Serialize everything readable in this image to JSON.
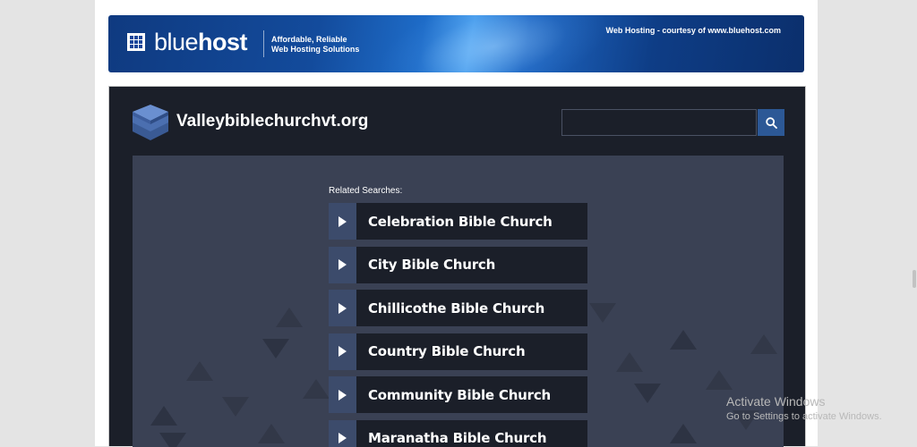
{
  "banner": {
    "brand_light": "blue",
    "brand_bold": "host",
    "tagline_line1": "Affordable, Reliable",
    "tagline_line2": "Web Hosting Solutions",
    "courtesy": "Web Hosting - courtesy of www.bluehost.com"
  },
  "site": {
    "title": "Valleybiblechurchvt.org",
    "search": {
      "value": "",
      "placeholder": ""
    },
    "related_label": "Related Searches:",
    "links": [
      {
        "label": "Celebration Bible Church"
      },
      {
        "label": "City Bible Church"
      },
      {
        "label": "Chillicothe Bible Church"
      },
      {
        "label": "Country Bible Church"
      },
      {
        "label": "Community Bible Church"
      },
      {
        "label": "Maranatha Bible Church"
      }
    ]
  },
  "watermark": {
    "line1": "Activate Windows",
    "line2": "Go to Settings to activate Windows."
  },
  "colors": {
    "banner_blue": "#134b9c",
    "site_dark": "#1b1f29",
    "content_slate": "#3a4154",
    "arrow_block": "#3c4b6b",
    "search_button": "#2c5896"
  },
  "icons": [
    "bluehost-grid-icon",
    "layers-logo-icon",
    "search-icon",
    "play-arrow-icon"
  ]
}
